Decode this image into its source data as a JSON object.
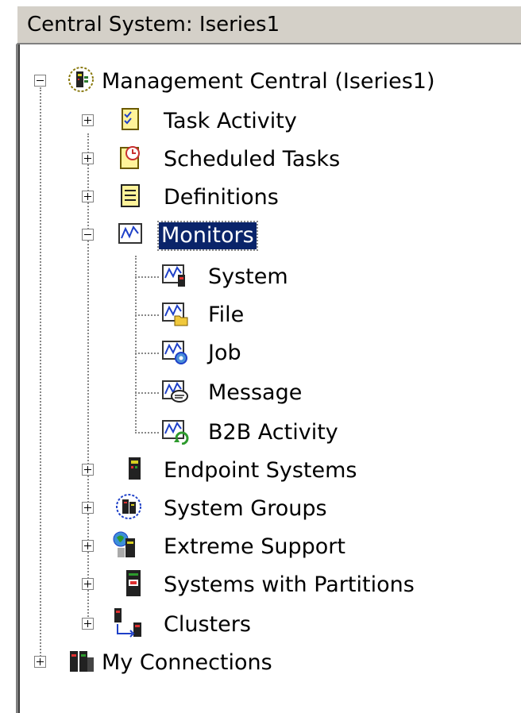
{
  "header": {
    "title": "Central System: Iseries1"
  },
  "tree": {
    "root_label": "Management Central (Iseries1)",
    "items": [
      {
        "label": "Task Activity"
      },
      {
        "label": "Scheduled Tasks"
      },
      {
        "label": "Definitions"
      },
      {
        "label": "Monitors",
        "selected": true,
        "expanded": true
      },
      {
        "label": "Endpoint Systems"
      },
      {
        "label": "System Groups"
      },
      {
        "label": "Extreme Support"
      },
      {
        "label": "Systems with Partitions"
      },
      {
        "label": "Clusters"
      }
    ],
    "monitors": [
      {
        "label": "System"
      },
      {
        "label": "File"
      },
      {
        "label": "Job"
      },
      {
        "label": "Message"
      },
      {
        "label": "B2B Activity"
      }
    ],
    "my_connections": "My Connections"
  },
  "colors": {
    "selection": "#0a246a",
    "panel": "#d4d0c8"
  },
  "icons": {
    "root": "management-central-icon",
    "task": "task-activity-icon",
    "scheduled": "scheduled-tasks-icon",
    "definitions": "definitions-icon",
    "monitors": "monitor-icon"
  }
}
